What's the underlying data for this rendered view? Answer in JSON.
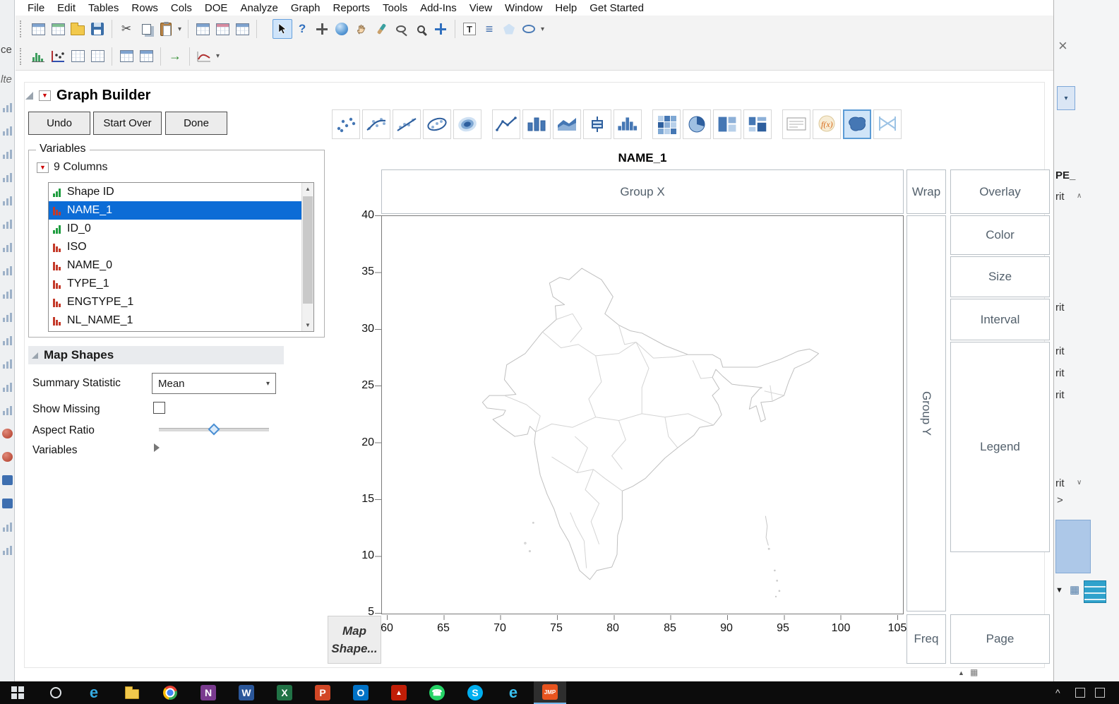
{
  "window": {
    "app": "JMP",
    "report_title": "Graph Builder"
  },
  "menubar": {
    "items": [
      "File",
      "Edit",
      "Tables",
      "Rows",
      "Cols",
      "DOE",
      "Analyze",
      "Graph",
      "Reports",
      "Tools",
      "Add-Ins",
      "View",
      "Window",
      "Help",
      "Get Started"
    ]
  },
  "toolbar_main": {
    "icons": [
      "new-data-table",
      "new-journal",
      "open",
      "save",
      "cut",
      "copy",
      "paste",
      "paste-menu-chevron",
      "summary",
      "subset",
      "tabulate",
      "arrow-tool",
      "help-tool",
      "scroller-tool",
      "selection-tool",
      "grabber-tool",
      "brush-tool",
      "lasso-tool",
      "magnifier-tool",
      "crosshair-tool",
      "annotate-text",
      "annotate-line",
      "annotate-polygon",
      "annotate-oval",
      "overflow-chevron"
    ],
    "selected_tool": "arrow-tool",
    "help_glyph": "?",
    "annotate_text_glyph": "T"
  },
  "toolbar_analysis": {
    "icons": [
      "distribution",
      "fit-y-by-x",
      "matched-pairs",
      "tabulate",
      "fit-model",
      "multivariate",
      "run-script",
      "profiler",
      "overflow-chevron"
    ]
  },
  "graph_builder": {
    "title": "Graph Builder",
    "buttons": [
      {
        "label": "Undo"
      },
      {
        "label": "Start Over"
      },
      {
        "label": "Done"
      }
    ],
    "element_palette": {
      "icons": [
        "points",
        "smoother",
        "line-of-fit",
        "ellipse",
        "contour",
        "line",
        "bar",
        "area",
        "box-plot",
        "histogram",
        "heatmap",
        "pie",
        "treemap",
        "mosaic",
        "caption-box",
        "formula",
        "map-shapes",
        "parallel-plot"
      ],
      "selected": "map-shapes"
    }
  },
  "variables_panel": {
    "title": "Variables",
    "columns_summary": "9 Columns",
    "items": [
      {
        "label": "Shape ID",
        "modeling_type": "ordinal",
        "selected": false
      },
      {
        "label": "NAME_1",
        "modeling_type": "nominal",
        "selected": true
      },
      {
        "label": "ID_0",
        "modeling_type": "ordinal",
        "selected": false
      },
      {
        "label": "ISO",
        "modeling_type": "nominal",
        "selected": false
      },
      {
        "label": "NAME_0",
        "modeling_type": "nominal",
        "selected": false
      },
      {
        "label": "TYPE_1",
        "modeling_type": "nominal",
        "selected": false
      },
      {
        "label": "ENGTYPE_1",
        "modeling_type": "nominal",
        "selected": false
      },
      {
        "label": "NL_NAME_1",
        "modeling_type": "nominal",
        "selected": false
      }
    ]
  },
  "map_shapes_panel": {
    "title": "Map Shapes",
    "summary_statistic_label": "Summary Statistic",
    "summary_statistic_value": "Mean",
    "show_missing_label": "Show Missing",
    "show_missing_checked": false,
    "aspect_ratio_label": "Aspect Ratio",
    "variables_label": "Variables"
  },
  "chart": {
    "title": "NAME_1",
    "zones": {
      "group_x": "Group X",
      "wrap": "Wrap",
      "overlay": "Overlay",
      "color": "Color",
      "size": "Size",
      "interval": "Interval",
      "legend": "Legend",
      "group_y": "Group Y",
      "freq": "Freq",
      "page": "Page",
      "map_shape": "Map Shape..."
    },
    "y_ticks": [
      "40",
      "35",
      "30",
      "25",
      "20",
      "15",
      "10",
      "5"
    ],
    "x_ticks": [
      "60",
      "65",
      "70",
      "75",
      "80",
      "85",
      "90",
      "95",
      "100",
      "105"
    ]
  },
  "chart_data": {
    "type": "map",
    "title": "NAME_1",
    "geography": "Outline map of India with first-level administrative (state) boundaries, plus Lakshadweep and Andaman & Nicobar islands",
    "x_axis": {
      "label": "",
      "ticks": [
        60,
        65,
        70,
        75,
        80,
        85,
        90,
        95,
        100,
        105
      ],
      "range": [
        59.5,
        105.6
      ]
    },
    "y_axis": {
      "label": "",
      "ticks": [
        40,
        35,
        30,
        25,
        20,
        15,
        10,
        5
      ],
      "range": [
        5.0,
        40.1
      ]
    },
    "grid": false,
    "legend": "none",
    "series": [
      {
        "name": "India shape outline",
        "type": "shape-outline",
        "stroke_color": "#bfbfbf",
        "fill": "none"
      }
    ]
  },
  "background_windows": {
    "left_fragments": [
      "ce",
      "lte"
    ],
    "right_top_fragment": "PE_",
    "right_fragments": [
      "rit",
      "rit",
      "rit",
      "rit",
      "rit",
      "rit"
    ],
    "right_chevron": ">",
    "close_glyph": "×"
  },
  "taskbar": {
    "icons": [
      {
        "name": "start"
      },
      {
        "name": "search"
      },
      {
        "name": "edge",
        "glyph": "e",
        "color": "#35abe2"
      },
      {
        "name": "file-explorer"
      },
      {
        "name": "chrome"
      },
      {
        "name": "onenote",
        "glyph": "N",
        "color": "#7a3b8f"
      },
      {
        "name": "word",
        "glyph": "W",
        "color": "#2b579a"
      },
      {
        "name": "excel",
        "glyph": "X",
        "color": "#217346"
      },
      {
        "name": "powerpoint",
        "glyph": "P",
        "color": "#d24726"
      },
      {
        "name": "outlook",
        "glyph": "O",
        "color": "#0072c6"
      },
      {
        "name": "acrobat",
        "glyph": "▲",
        "color": "#c11e07"
      },
      {
        "name": "whatsapp",
        "glyph": "☎",
        "color": "#25d366"
      },
      {
        "name": "skype",
        "glyph": "S",
        "color": "#00aff0"
      },
      {
        "name": "internet-explorer",
        "glyph": "e",
        "color": "#39c1f0"
      },
      {
        "name": "jmp",
        "glyph": "JMP",
        "active": true
      }
    ],
    "tray_chevron": "^"
  },
  "colors": {
    "selection_blue": "#0c6cd6",
    "zone_border": "#b9c0c6",
    "zone_text": "#53606c",
    "jmp_icon_blue": "#4577b4",
    "palette_selected_bg": "#cfe4f8",
    "map_outline": "#bfbfbf"
  }
}
